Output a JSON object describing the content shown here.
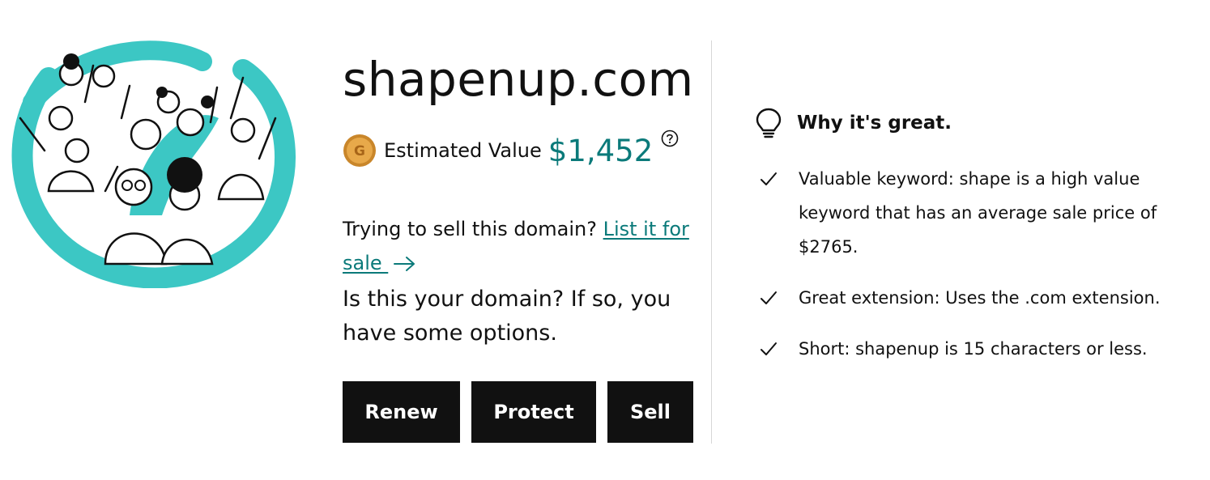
{
  "domain": {
    "name": "shapenup.com",
    "estimated_value_label": "Estimated Value",
    "estimated_value": "$1,452"
  },
  "sell_prompt": {
    "text": "Trying to sell this domain? ",
    "link_label": "List it for sale "
  },
  "owner_prompt": "Is this your domain? If so, you have some options.",
  "actions": {
    "renew": "Renew",
    "protect": "Protect",
    "sell": "Sell"
  },
  "why_great": {
    "title": "Why it's great.",
    "reasons": [
      "Valuable keyword: shape is a high value keyword that has an average sale price of $2765.",
      "Great extension: Uses the .com extension.",
      "Short: shapenup is 15 characters or less."
    ]
  },
  "colors": {
    "accent_teal": "#0b7a7a",
    "button_bg": "#111111",
    "illustration_teal": "#3cc7c4",
    "coin_gold": "#e0a040"
  },
  "icons": {
    "hero": "people-crowd-illustration",
    "coin": "coin-icon",
    "help": "question-circle-icon",
    "link_arrow": "arrow-right-icon",
    "bulb": "lightbulb-icon",
    "check": "check-icon"
  }
}
